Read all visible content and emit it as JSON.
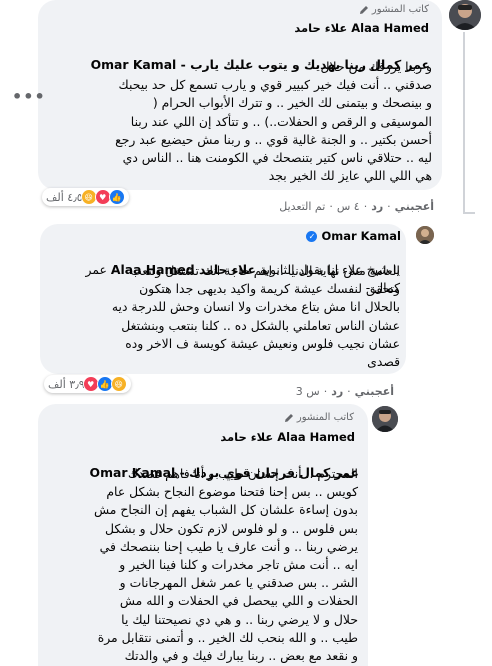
{
  "comments": [
    {
      "author": "علاء حامد Alaa Hamed",
      "badge": "كاتب المنشور",
      "mention_line": {
        "name": "Omar Kamal",
        "sep": " - ",
        "text": "عمر كمال ربنا يهديك و يتوب عليك يارب"
      },
      "body": "و ربنا يرزقك من حلال\nصدقني .. أنت فيك خير كبيير قوي و يارب تسمع كل حد بيحبك\nو بينصحك و بيتمنى لك الخير .. و تترك الأبواب الحرام (\nالموسيقى و الرقص و الحفلات..) .. و تتأكد إن اللي عند ربنا\nأحسن بكتير .. و الجنة غالية قوي .. و ربنا مش حيضيع عبد رجع\nليه .. حتلاقي ناس كتير بتنصحك في الكومنت هنا .. الناس دي\nهي اللي اللي عايز لك الخير بجد",
      "reaction_count": "٤٫٥ ألف",
      "actions": {
        "like": "أعجبني",
        "reply": "رد",
        "time": "٤ س",
        "edited": "تم التعديل"
      }
    },
    {
      "author": "Omar Kamal",
      "verified": true,
      "mention_line": {
        "name": "علاء حامد Alaa Hamed",
        "prefix": "عمر كمال - ",
        "text": "يا شيخ علاء انا بقول الثانوية"
      },
      "body": "العامة مش نهاية الدنيا .. اهم حاجة انك تشتغل وتتعب\nوتحقق لنفسك عيشة كريمة واكيد بديهى جدا هتكون\nبالحلال انا مش بتاع مخدرات ولا انسان وحش للدرجة ديه\nعشان الناس تعاملني بالشكل ده .. كلنا بنتعب وبنشتغل\nعشان نجيب فلوس ونعيش عيشة كويسة ف الاخر وده\nقصدى",
      "reaction_count": "٣٫٩ ألف",
      "actions": {
        "like": "أعجبني",
        "reply": "رد",
        "time": "3 س"
      }
    },
    {
      "author": "علاء حامد Alaa Hamed",
      "badge": "كاتب المنشور",
      "mention_line": {
        "name": "Omar Kamal",
        "sep": " - ",
        "text": "عمر كمال فرحان قوي بردك"
      },
      "body": "المحترم .. أنت إنسان طيب و أنا فاهم قصدك\nكويس .. بس إحنا فتحنا موضوع النجاح بشكل عام\nبدون إساءة علشان كل الشباب يفهم إن النجاح مش\nبس فلوس .. و لو فلوس لازم تكون حلال و بشكل\nيرضي ربنا .. و أنت عارف يا طيب إحنا بننصحك في\nايه .. أنت مش تاجر مخدرات و كلنا فينا الخير و\nالشر .. بس صدقني يا عمر شغل المهرجانات و\nالحفلات و اللي بيحصل في الحفلات و الله مش\nحلال و لا يرضي ربنا .. و هي دي نصيحتنا ليك يا\nطيب .. و الله بنحب لك الخير .. و أتمنى نتقابل مرة\nو نقعد مع بعض .. ربنا يبارك فيك و في والدتك"
    }
  ],
  "colors": {
    "like": "#1877f2",
    "love": "#f33e58",
    "haha": "#f7b125",
    "bubble": "#f0f2f5",
    "muted": "#65676b"
  },
  "icons": {
    "badge": "pencil-icon",
    "verified": "verified-check-icon",
    "more": "more-options-icon"
  },
  "more_label": "•••"
}
